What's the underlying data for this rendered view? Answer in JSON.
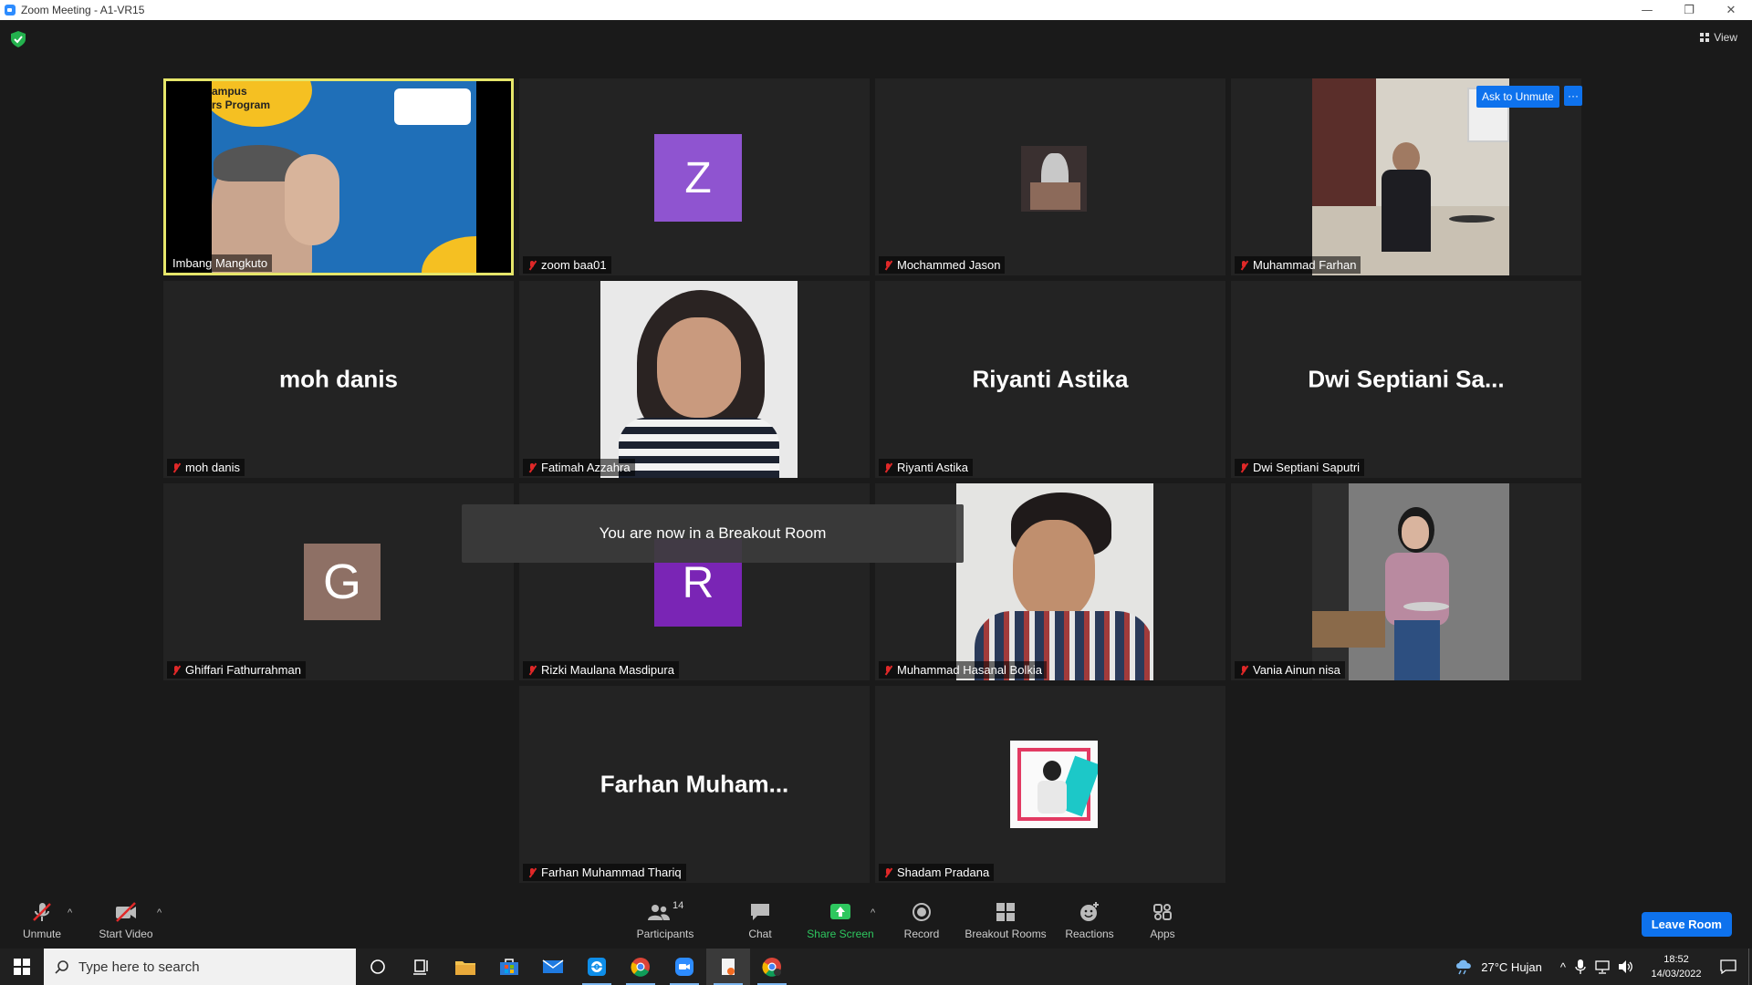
{
  "window": {
    "title": "Zoom Meeting - A1-VR15",
    "controls": [
      "—",
      "❐",
      "✕"
    ]
  },
  "top_right": {
    "view_label": "View"
  },
  "overlay": {
    "toast": "You are now in a Breakout Room",
    "ask_to_unmute": "Ask to Unmute",
    "more": "···"
  },
  "participants": [
    {
      "name": "Imbang Mangkuto",
      "muted": false,
      "kind": "video",
      "slide_text_1": "ampus",
      "slide_text_2": "rs Program"
    },
    {
      "name": "zoom baa01",
      "muted": true,
      "kind": "letter",
      "letter": "Z",
      "color": "#8f54d0"
    },
    {
      "name": "Mochammed Jason",
      "muted": true,
      "kind": "photo-small"
    },
    {
      "name": "Muhammad Farhan",
      "muted": true,
      "kind": "video"
    },
    {
      "name": "moh danis",
      "muted": true,
      "kind": "text",
      "display": "moh danis"
    },
    {
      "name": "Fatimah Azzahra",
      "muted": true,
      "kind": "video"
    },
    {
      "name": "Riyanti Astika",
      "muted": true,
      "kind": "text",
      "display": "Riyanti Astika"
    },
    {
      "name": "Dwi Septiani Saputri",
      "muted": true,
      "kind": "text",
      "display": "Dwi  Septiani  Sa..."
    },
    {
      "name": "Ghiffari Fathurrahman",
      "muted": true,
      "kind": "letter",
      "letter": "G",
      "color": "#8e7065"
    },
    {
      "name": "Rizki Maulana Masdipura",
      "muted": true,
      "kind": "letter",
      "letter": "R",
      "color": "#7a25b5"
    },
    {
      "name": "Muhammad Hasanal Bolkia",
      "muted": true,
      "kind": "video"
    },
    {
      "name": "Vania Ainun nisa",
      "muted": true,
      "kind": "video"
    },
    {
      "name": "Farhan Muhammad Thariq",
      "muted": true,
      "kind": "text",
      "display": "Farhan  Muham..."
    },
    {
      "name": "Shadam Pradana",
      "muted": true,
      "kind": "photo-small"
    }
  ],
  "toolbar": {
    "unmute": "Unmute",
    "start_video": "Start Video",
    "participants": "Participants",
    "participants_count": "14",
    "chat": "Chat",
    "share_screen": "Share Screen",
    "record": "Record",
    "breakout_rooms": "Breakout Rooms",
    "reactions": "Reactions",
    "apps": "Apps",
    "leave": "Leave Room"
  },
  "taskbar": {
    "search_placeholder": "Type here to search",
    "weather": "27°C  Hujan",
    "time": "18:52",
    "date": "14/03/2022"
  },
  "colors": {
    "accent": "#0e72ed",
    "active_speaker": "#e6e66a",
    "mute": "#e02828",
    "share": "#2ec75f"
  }
}
